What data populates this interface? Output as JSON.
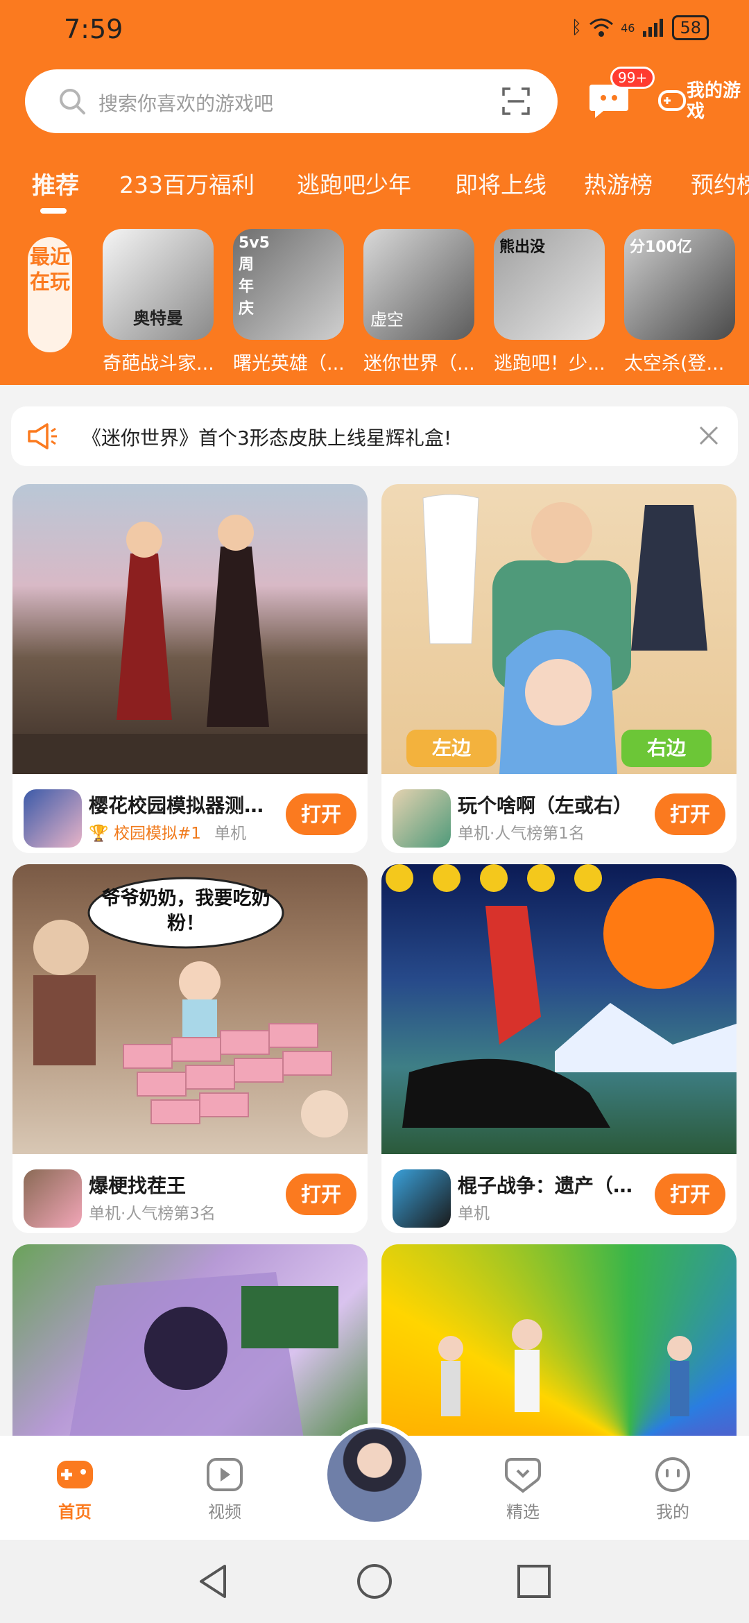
{
  "status_bar": {
    "time": "7:59",
    "battery": "58",
    "network": "46"
  },
  "search": {
    "placeholder": "搜索你喜欢的游戏吧"
  },
  "header": {
    "message_badge": "99+",
    "my_game_label": "我的游戏"
  },
  "tabs": [
    {
      "label": "推荐",
      "active": true
    },
    {
      "label": "233百万福利"
    },
    {
      "label": "逃跑吧少年"
    },
    {
      "label": "即将上线"
    },
    {
      "label": "热游榜"
    },
    {
      "label": "预约榜"
    }
  ],
  "recent": {
    "label": "最近在玩",
    "items": [
      {
        "name": "奇葩战斗家...",
        "thumb_text": "奥特曼"
      },
      {
        "name": "曙光英雄（...",
        "thumb_text": "5v5 周年庆"
      },
      {
        "name": "迷你世界（...",
        "thumb_text": "虚空"
      },
      {
        "name": "逃跑吧！少...",
        "thumb_text": "熊出没"
      },
      {
        "name": "太空杀(登...",
        "thumb_text": "分100亿"
      }
    ]
  },
  "notice": {
    "text": "《迷你世界》首个3形态皮肤上线星辉礼盒!"
  },
  "cards": [
    {
      "title": "樱花校园模拟器测试版",
      "rank": "校园模拟#1",
      "sub": "单机",
      "button": "打开"
    },
    {
      "title": "玩个啥啊（左或右）",
      "rank": "",
      "sub": "单机·人气榜第1名",
      "button": "打开",
      "img_left": "左边",
      "img_right": "右边"
    },
    {
      "title": "爆梗找茬王",
      "rank": "",
      "sub": "单机·人气榜第3名",
      "button": "打开",
      "img_bubble": "爷爷奶奶，我要吃奶粉！"
    },
    {
      "title": "棍子战争：遗产（无...",
      "rank": "",
      "sub": "单机",
      "button": "打开"
    }
  ],
  "bottom_nav": [
    {
      "label": "首页",
      "active": true
    },
    {
      "label": "视频"
    },
    {
      "label": "精选"
    },
    {
      "label": "我的"
    }
  ],
  "colors": {
    "brand": "#fb7a1f",
    "badge": "#ff3b30"
  }
}
